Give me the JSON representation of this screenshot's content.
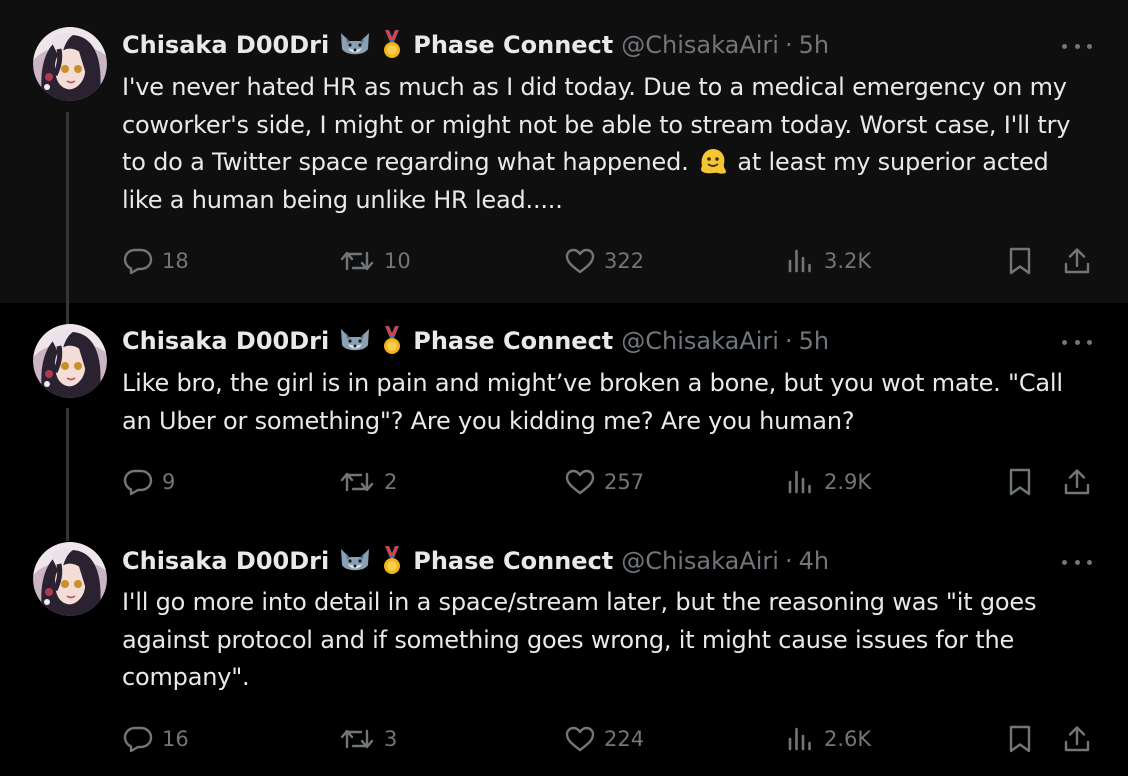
{
  "colors": {
    "background": "#000000",
    "highlight_background": "#0f0f0f",
    "text_primary": "#e7e9ea",
    "text_secondary": "#71767b",
    "thread_line": "#333639"
  },
  "tweets": [
    {
      "author": {
        "name": "Chisaka D00Dri",
        "badge_icons": [
          "wolf-emoji-icon",
          "medal-emoji-icon"
        ],
        "affiliation": "Phase Connect",
        "handle": "@ChisakaAiri"
      },
      "separator": "·",
      "time": "5h",
      "text": {
        "before_emoji": "I've never hated HR as much as I did today. Due to a medical emergency on my coworker's side, I might or might not be able to stream today. Worst case, I'll try to do a Twitter space regarding what happened. ",
        "emoji_icon": "melting-face-emoji-icon",
        "after_emoji": " at least my superior acted like a human being unlike HR lead....."
      },
      "stats": {
        "replies": "18",
        "reposts": "10",
        "likes": "322",
        "views": "3.2K"
      }
    },
    {
      "author": {
        "name": "Chisaka D00Dri",
        "badge_icons": [
          "wolf-emoji-icon",
          "medal-emoji-icon"
        ],
        "affiliation": "Phase Connect",
        "handle": "@ChisakaAiri"
      },
      "separator": "·",
      "time": "5h",
      "text": {
        "body": "Like bro, the girl is in pain and might’ve broken a bone, but you wot mate. \"Call an Uber or something\"? Are you kidding me? Are you human?"
      },
      "stats": {
        "replies": "9",
        "reposts": "2",
        "likes": "257",
        "views": "2.9K"
      }
    },
    {
      "author": {
        "name": "Chisaka D00Dri",
        "badge_icons": [
          "wolf-emoji-icon",
          "medal-emoji-icon"
        ],
        "affiliation": "Phase Connect",
        "handle": "@ChisakaAiri"
      },
      "separator": "·",
      "time": "4h",
      "text": {
        "body": "I'll go more into detail in a space/stream later, but the reasoning was \"it goes against protocol and if something goes wrong, it might cause issues for the company\"."
      },
      "stats": {
        "replies": "16",
        "reposts": "3",
        "likes": "224",
        "views": "2.6K"
      }
    }
  ],
  "icons": {
    "more": "more-options-icon",
    "reply": "reply-icon",
    "repost": "repost-icon",
    "like": "like-icon",
    "views": "views-icon",
    "bookmark": "bookmark-icon",
    "share": "share-icon"
  }
}
